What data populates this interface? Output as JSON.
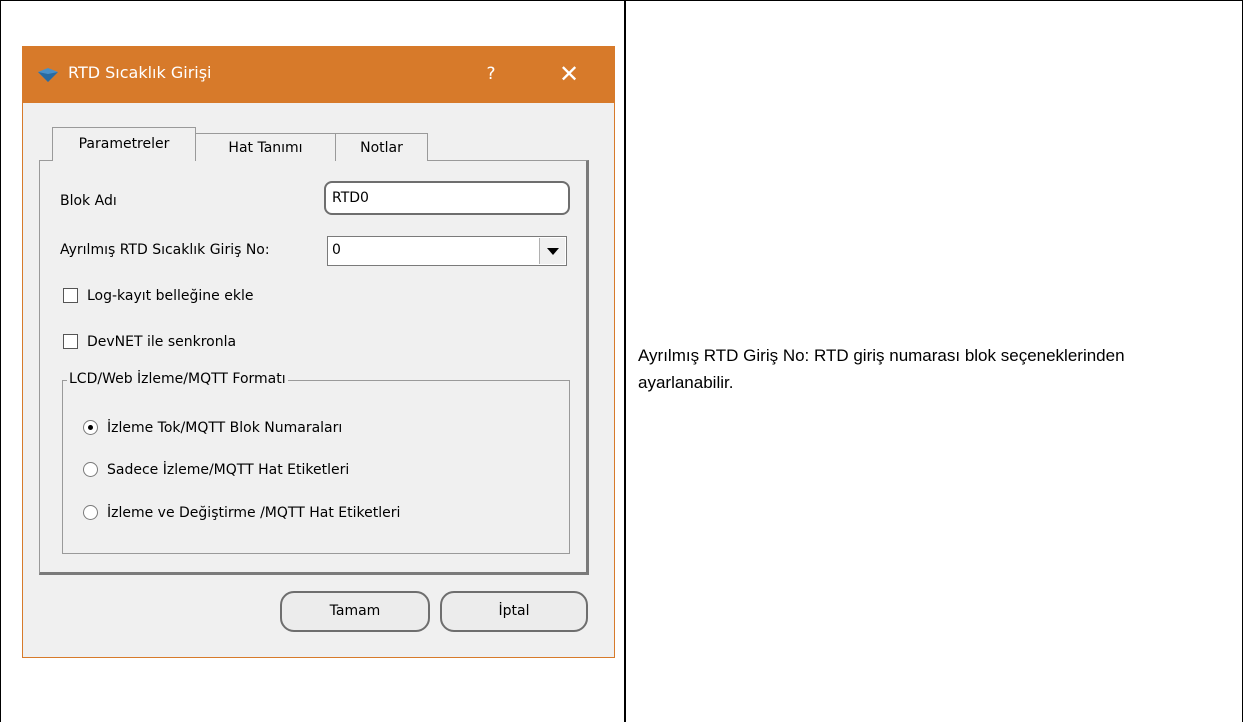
{
  "dialog": {
    "title": "RTD Sıcaklık Girişi",
    "help_label": "?",
    "close_label": "✕",
    "accent_color": "#d77a2a",
    "tabs": [
      {
        "label": "Parametreler",
        "active": true
      },
      {
        "label": "Hat Tanımı",
        "active": false
      },
      {
        "label": "Notlar",
        "active": false
      }
    ],
    "block_name": {
      "label": "Blok Adı",
      "value": "RTD0"
    },
    "rtd_input": {
      "label": "Ayrılmış RTD Sıcaklık Giriş No:",
      "value": "0"
    },
    "checkboxes": [
      {
        "label": "Log-kayıt belleğine ekle",
        "checked": false
      },
      {
        "label": "DevNET ile senkronla",
        "checked": false
      }
    ],
    "format_group": {
      "title": "LCD/Web İzleme/MQTT Formatı",
      "options": [
        {
          "label": "İzleme Tok/MQTT Blok Numaraları",
          "checked": true
        },
        {
          "label": "Sadece İzleme/MQTT Hat Etiketleri",
          "checked": false
        },
        {
          "label": "İzleme ve Değiştirme /MQTT Hat Etiketleri",
          "checked": false
        }
      ]
    },
    "ok_label": "Tamam",
    "cancel_label": "İptal"
  },
  "description": "Ayrılmış RTD Giriş No:  RTD giriş numarası blok seçeneklerinden ayarlanabilir."
}
